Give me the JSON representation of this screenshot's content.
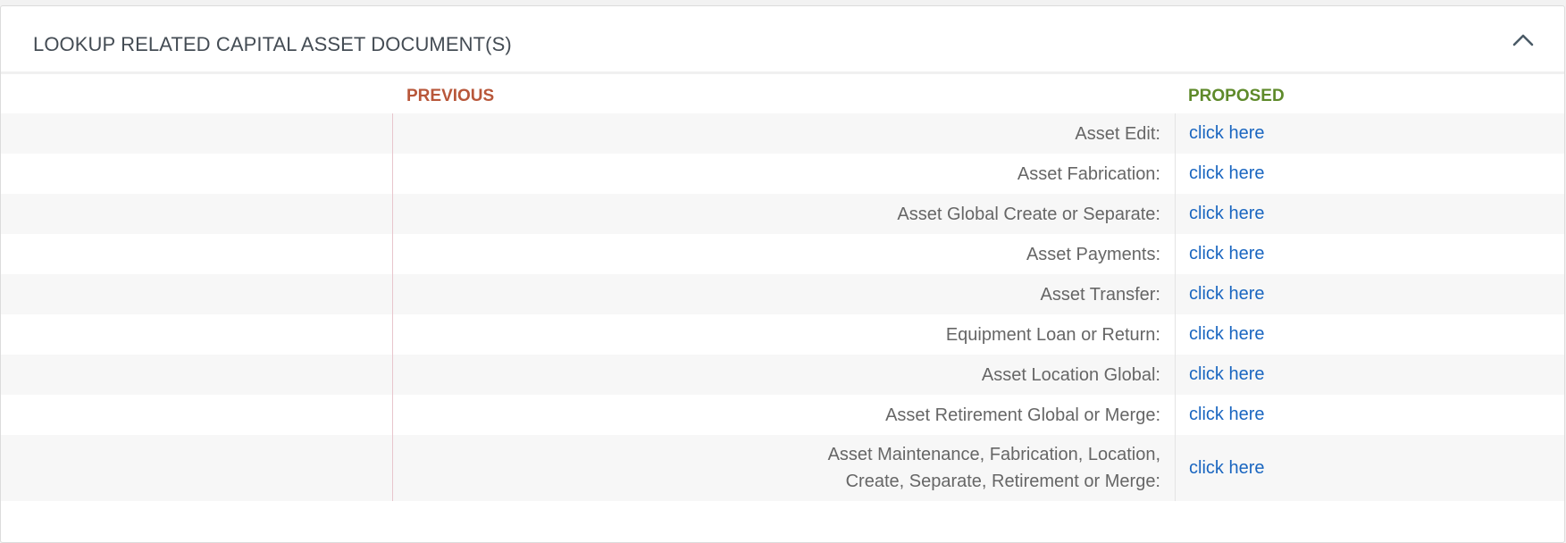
{
  "section": {
    "title": "LOOKUP RELATED CAPITAL ASSET DOCUMENT(S)",
    "collapse_icon": "chevron-up-icon"
  },
  "columns": {
    "previous": "PREVIOUS",
    "proposed": "PROPOSED"
  },
  "rows": [
    {
      "label": "Asset Edit:",
      "link": "click here"
    },
    {
      "label": "Asset Fabrication:",
      "link": "click here"
    },
    {
      "label": "Asset Global Create or Separate:",
      "link": "click here"
    },
    {
      "label": "Asset Payments:",
      "link": "click here"
    },
    {
      "label": "Asset Transfer:",
      "link": "click here"
    },
    {
      "label": "Equipment Loan or Return:",
      "link": "click here"
    },
    {
      "label": "Asset Location Global:",
      "link": "click here"
    },
    {
      "label": "Asset Retirement Global or Merge:",
      "link": "click here"
    },
    {
      "label_line1": "Asset Maintenance, Fabrication, Location,",
      "label_line2": "Create, Separate, Retirement or Merge:",
      "link": "click here"
    }
  ],
  "colors": {
    "previous": "#b8573a",
    "proposed": "#5e8a2a",
    "link": "#1a66c0"
  }
}
